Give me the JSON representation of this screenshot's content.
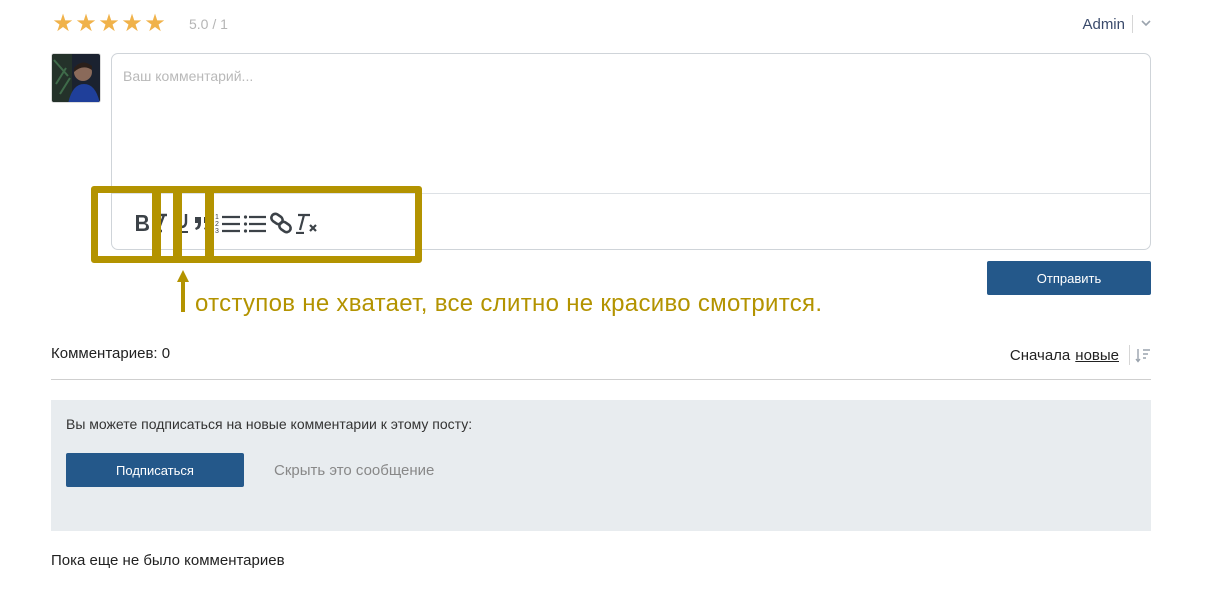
{
  "rating": {
    "stars": 5,
    "text": "5.0 / 1",
    "star_color": "#f0b24a"
  },
  "user_menu": {
    "name": "Admin",
    "chevron_icon": "chevron-down-icon"
  },
  "editor": {
    "placeholder": "Ваш комментарий...",
    "toolbar": [
      "bold",
      "italic",
      "underline",
      "blockquote",
      "numbered-list",
      "bulleted-list",
      "link",
      "clear-formatting"
    ]
  },
  "annotation": {
    "text": "отступов не хватает, все слитно не красиво смотрится.",
    "color": "#b39300"
  },
  "actions": {
    "send_label": "Отправить"
  },
  "comments": {
    "count_label": "Комментариев: 0",
    "sort_prefix": "Сначала",
    "sort_value": "новые"
  },
  "subscribe": {
    "text": "Вы можете подписаться на новые комментарии к этому посту:",
    "button_label": "Подписаться",
    "hide_label": "Скрыть это сообщение"
  },
  "empty_state": "Пока еще не было комментариев",
  "colors": {
    "primary": "#24588a",
    "panel_bg": "#e8ecef"
  }
}
